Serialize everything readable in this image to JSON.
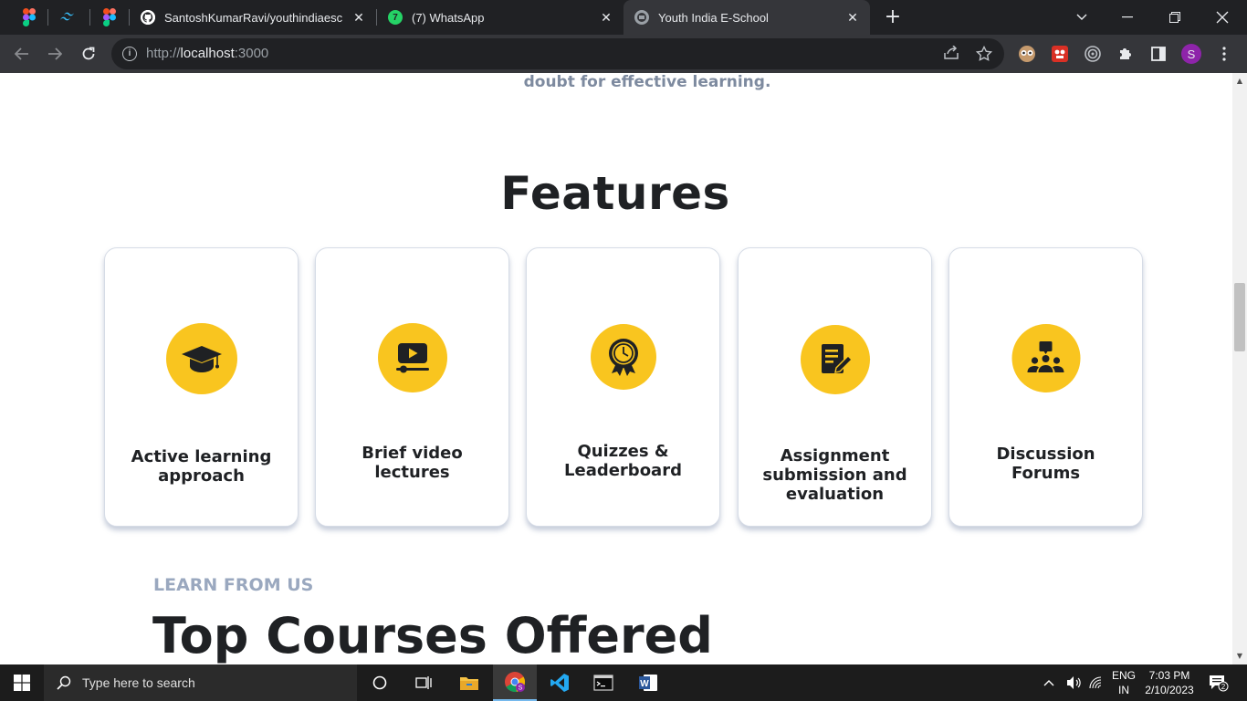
{
  "browser": {
    "tabs": [
      {
        "title": "SantoshKumarRavi/youthindiaesc",
        "active": false
      },
      {
        "title": "(7) WhatsApp",
        "active": false,
        "badge": "7"
      },
      {
        "title": "Youth India E-School",
        "active": true
      }
    ],
    "new_tab": "+",
    "url": {
      "scheme": "http://",
      "host": "localhost",
      "port": ":3000"
    },
    "profile_initial": "S"
  },
  "page": {
    "intro_tail": "doubt for effective learning.",
    "features_title": "Features",
    "features": [
      {
        "label_line1": "Active learning",
        "label_line2": "approach",
        "label_line3": "",
        "icon": "graduation-cap-icon"
      },
      {
        "label_line1": "Brief video",
        "label_line2": "lectures",
        "label_line3": "",
        "icon": "video-lecture-icon"
      },
      {
        "label_line1": "Quizzes &",
        "label_line2": "Leaderboard",
        "label_line3": "",
        "icon": "award-badge-icon"
      },
      {
        "label_line1": "Assignment",
        "label_line2": "submission and",
        "label_line3": "evaluation",
        "icon": "assignment-edit-icon"
      },
      {
        "label_line1": "Discussion",
        "label_line2": "Forums",
        "label_line3": "",
        "icon": "discussion-group-icon"
      }
    ],
    "section_kicker": "LEARN FROM US",
    "section_title": "Top Courses Offered"
  },
  "taskbar": {
    "search_placeholder": "Type here to search",
    "language_line1": "ENG",
    "language_line2": "IN",
    "time": "7:03 PM",
    "date": "2/10/2023",
    "notification_count": "2"
  },
  "colors": {
    "accent_yellow": "#f9c51f",
    "heading_dark": "#1f2124",
    "muted_blue_gray": "#9aa8bf"
  }
}
